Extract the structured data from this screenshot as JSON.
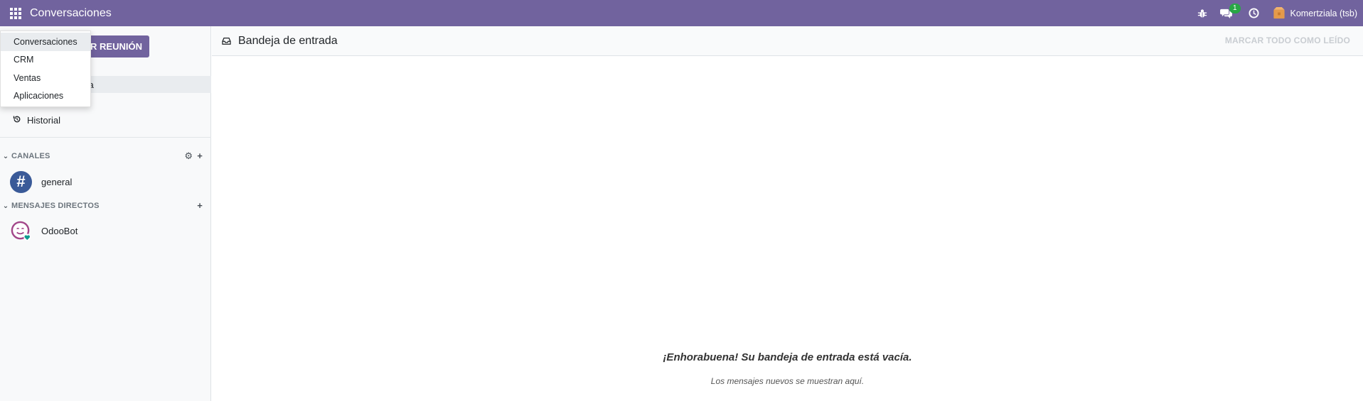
{
  "navbar": {
    "app_title": "Conversaciones",
    "notification_count": "1",
    "company": "Komertziala (tsb)",
    "icons": [
      "apps-grid-icon",
      "bug-icon",
      "chat-icon",
      "clock-icon",
      "company-icon"
    ]
  },
  "app_menu": {
    "items": [
      {
        "label": "Conversaciones"
      },
      {
        "label": "CRM"
      },
      {
        "label": "Ventas"
      },
      {
        "label": "Aplicaciones"
      }
    ]
  },
  "sidebar": {
    "start_meeting_label": "AR REUNIÓN",
    "inbox_label_partial": "ada",
    "history_label": "Historial",
    "channels_header": "CANALES",
    "channels": [
      {
        "name": "general"
      }
    ],
    "direct_header": "MENSAJES DIRECTOS",
    "direct": [
      {
        "name": "OdooBot"
      }
    ]
  },
  "main": {
    "title": "Bandeja de entrada",
    "mark_all_label": "MARCAR TODO COMO LEÍDO",
    "empty_title": "¡Enhorabuena! Su bandeja de entrada está vacía.",
    "empty_subtitle": "Los mensajes nuevos se muestran aquí."
  },
  "colors": {
    "brand": "#71639e",
    "badge": "#28a745",
    "channel_avatar": "#3a5a98"
  }
}
